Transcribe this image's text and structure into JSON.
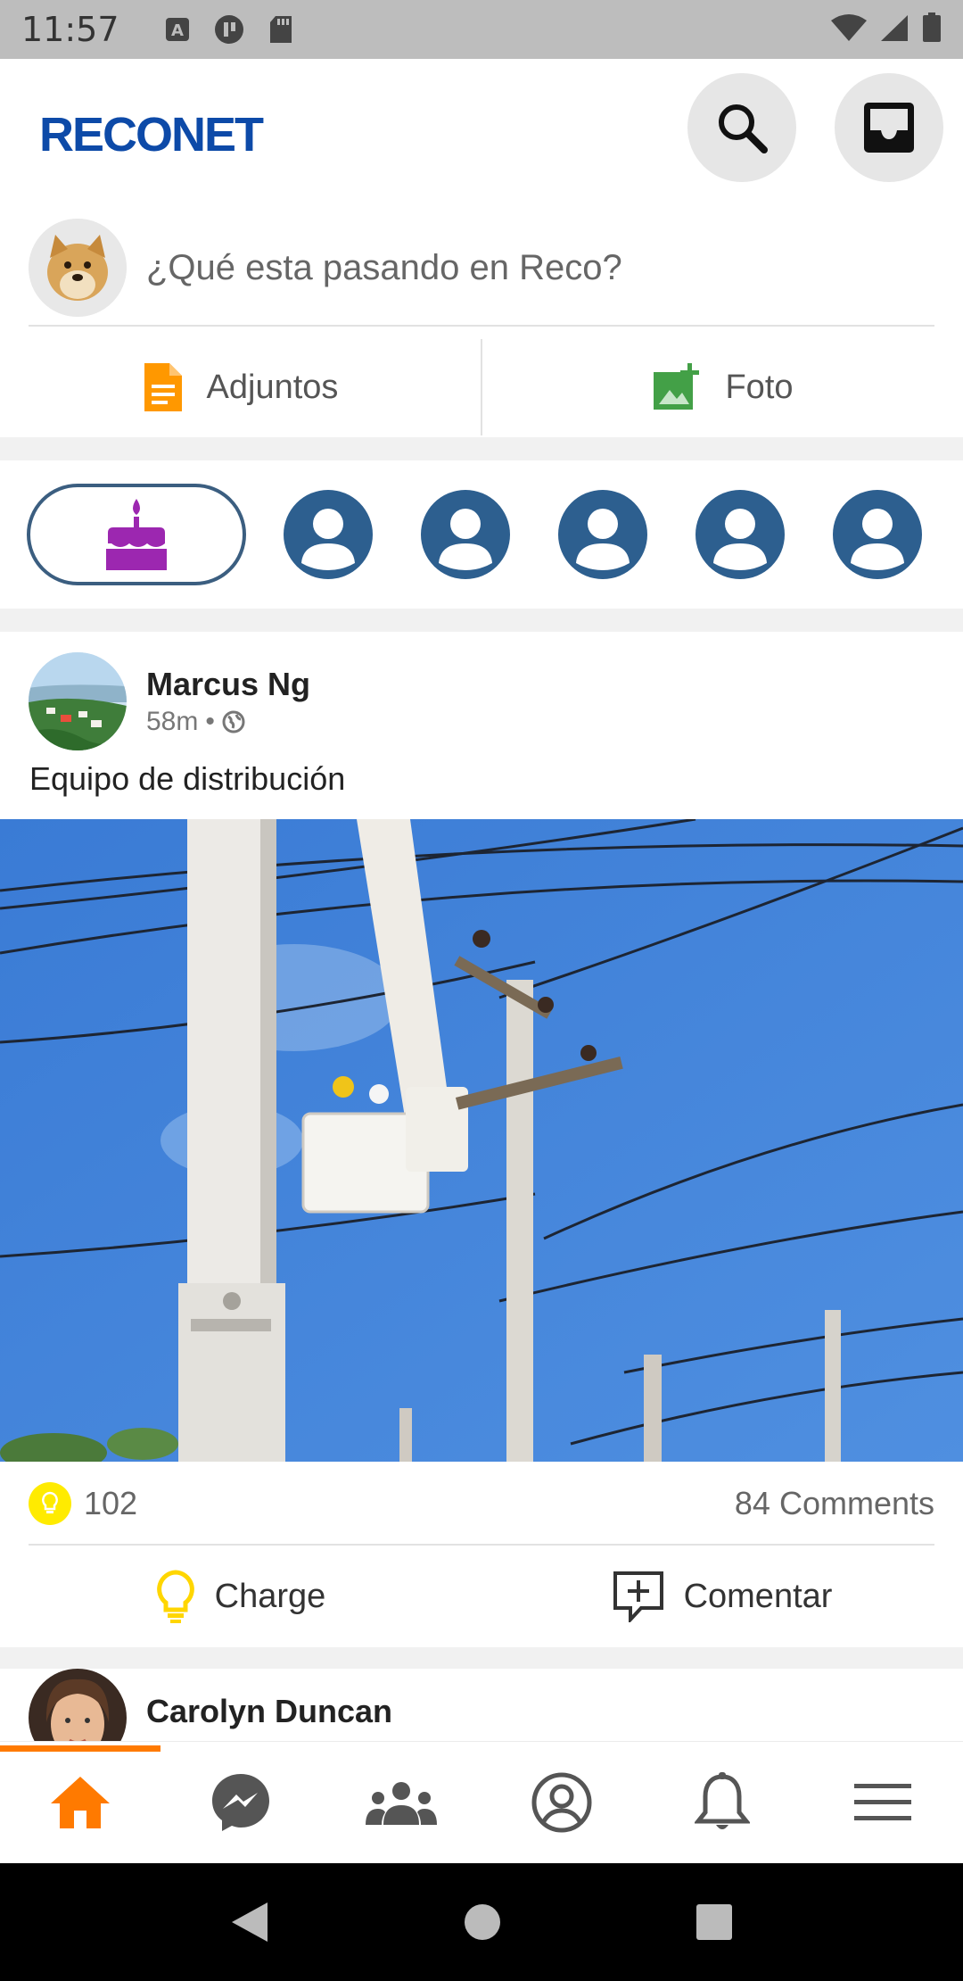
{
  "status_bar": {
    "time": "11:57"
  },
  "app": {
    "brand": "RECONET"
  },
  "composer": {
    "placeholder": "¿Qué esta pasando en Reco?"
  },
  "composer_actions": [
    {
      "label": "Adjuntos",
      "icon": "document-icon"
    },
    {
      "label": "Foto",
      "icon": "add-photo-icon"
    }
  ],
  "post": {
    "author": "Marcus Ng",
    "time": "58m",
    "separator": "•",
    "visibility_icon": "globe-icon",
    "text": "Equipo de distribución",
    "reaction_count": "102",
    "comments": "84 Comments",
    "actions": {
      "charge": "Charge",
      "comment": "Comentar"
    }
  },
  "next_post": {
    "author": "Carolyn Duncan"
  },
  "colors": {
    "brand": "#0d4aa8",
    "accent": "#ff7a00",
    "story_avatar": "#2d5f8f",
    "birthday": "#9c27b0"
  }
}
